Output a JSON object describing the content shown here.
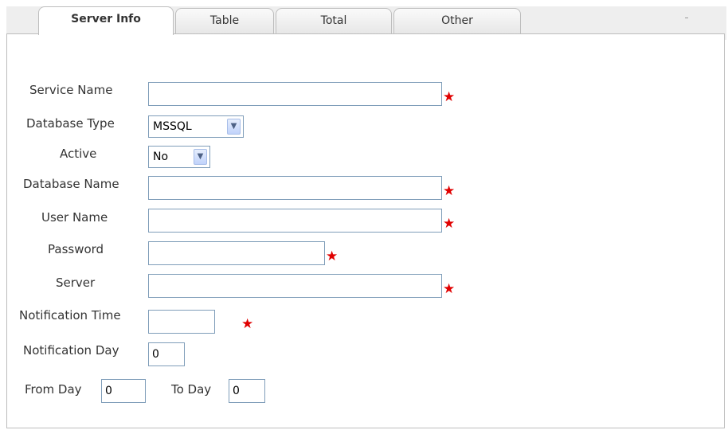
{
  "tabs": [
    {
      "label": "Server Info"
    },
    {
      "label": "Table"
    },
    {
      "label": "Total"
    },
    {
      "label": "Other"
    }
  ],
  "form": {
    "service_name": {
      "label": "Service Name",
      "value": ""
    },
    "database_type": {
      "label": "Database Type",
      "selected": "MSSQL"
    },
    "active": {
      "label": "Active",
      "selected": "No"
    },
    "database_name": {
      "label": "Database Name",
      "value": ""
    },
    "user_name": {
      "label": "User Name",
      "value": ""
    },
    "password": {
      "label": "Password",
      "value": ""
    },
    "server": {
      "label": "Server",
      "value": ""
    },
    "notification_time": {
      "label": "Notification Time",
      "value": ""
    },
    "notification_day": {
      "label": "Notification Day",
      "value": "0"
    },
    "from_day": {
      "label": "From Day",
      "value": "0"
    },
    "to_day": {
      "label": "To Day",
      "value": "0"
    }
  },
  "required_marker": "★",
  "colors": {
    "required": "#e00000",
    "input_border": "#7f9db9",
    "tab_border": "#bdbdbd"
  }
}
